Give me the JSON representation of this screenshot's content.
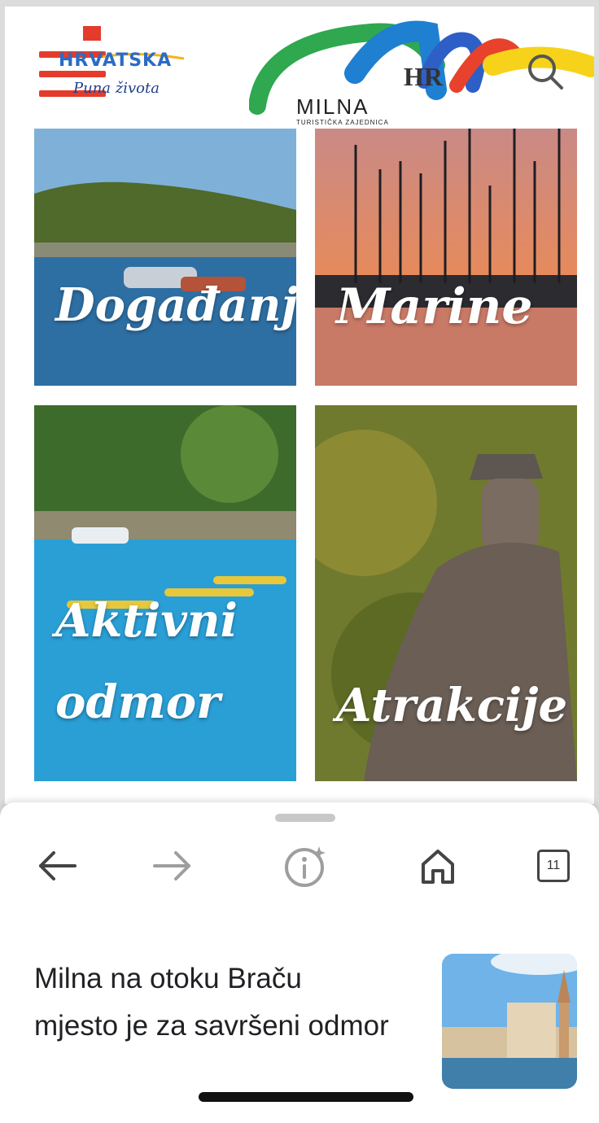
{
  "header": {
    "hrvatska_logo_text": "HRVATSKA",
    "hrvatska_logo_subtitle": "Puna života",
    "milna_logo_hr": "HR",
    "milna_logo_name": "MILNA",
    "milna_logo_tagline": "TURISTIČKA ZAJEDNICA"
  },
  "tiles": [
    {
      "label": "Događanja"
    },
    {
      "label": "Marine"
    },
    {
      "label_line1": "Aktivni",
      "label_line2": "odmor"
    },
    {
      "label": "Atrakcije"
    }
  ],
  "browser": {
    "tab_count": "11",
    "article_title": "Milna na otoku Braču mjesto je za savršeni odmor"
  },
  "colors": {
    "hamburger": "#e43b2c",
    "nav_icon": "#444444",
    "nav_icon_disabled": "#9e9e9e"
  }
}
